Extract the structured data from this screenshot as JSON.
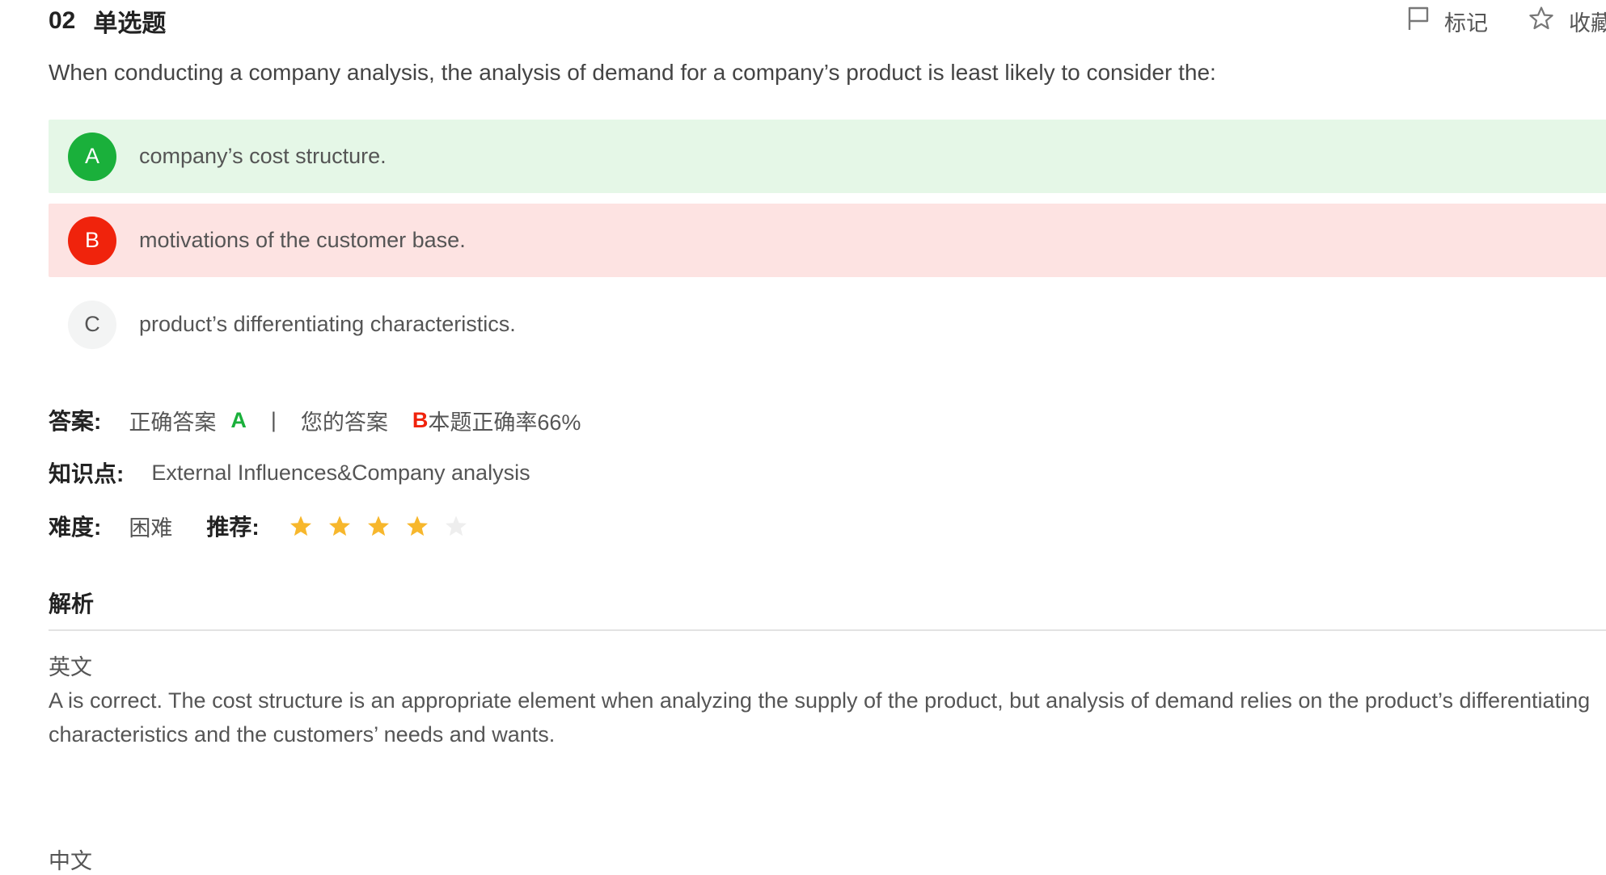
{
  "header": {
    "number": "02",
    "type": "单选题",
    "mark_label": "标记",
    "collect_label": "收藏"
  },
  "question": {
    "text": "When conducting a company analysis, the analysis of demand for a company’s product is least likely to consider the:"
  },
  "options": [
    {
      "letter": "A",
      "text": "company’s cost structure.",
      "state": "correct"
    },
    {
      "letter": "B",
      "text": "motivations of the customer base.",
      "state": "wrong"
    },
    {
      "letter": "C",
      "text": "product’s differentiating characteristics.",
      "state": "neutral"
    }
  ],
  "answer": {
    "label": "答案:",
    "correct_label": "正确答案",
    "correct_value": "A",
    "separator": "|",
    "your_label": "您的答案",
    "your_value": "B",
    "accuracy_text": "本题正确率66%"
  },
  "topic": {
    "label": "知识点:",
    "value": "External Influences&Company analysis"
  },
  "difficulty": {
    "label": "难度:",
    "value": "困难",
    "recommend_label": "推荐:",
    "rating": 4,
    "max_rating": 5
  },
  "analysis": {
    "title": "解析",
    "en_label": "英文",
    "en_line1": "A is correct. The cost structure is an appropriate element when analyzing the supply of the product, but analysis of demand relies on the product’s differentiating",
    "en_line2": "characteristics and the customers’ needs and wants.",
    "zh_label": "中文"
  },
  "colors": {
    "correct": "#1ab03b",
    "wrong": "#f0230c",
    "correct_bg": "#e5f7e7",
    "wrong_bg": "#fde3e2",
    "star_on": "#f7b72c",
    "star_off": "#eeeeee"
  },
  "icons": {
    "mark": "flag-icon",
    "collect": "star-outline-icon",
    "rating": "star-icon"
  }
}
